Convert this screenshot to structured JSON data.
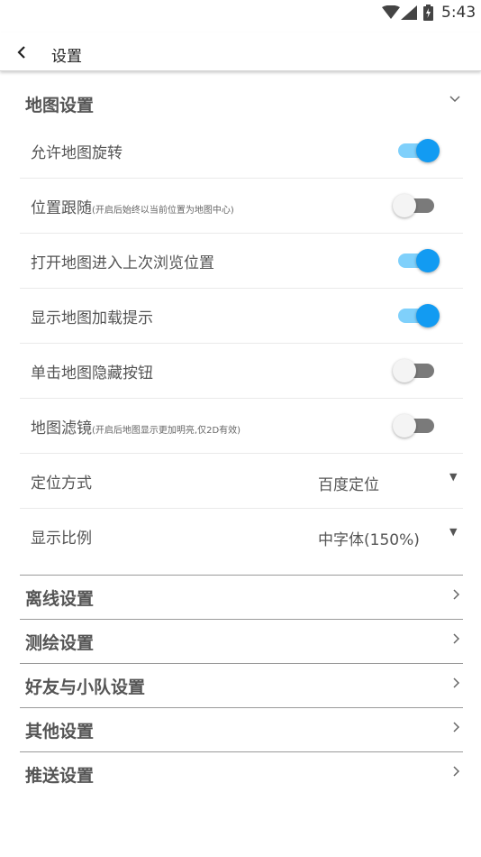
{
  "status_bar": {
    "time": "5:43",
    "wifi_icon": "wifi-icon",
    "signal_icon": "cell-signal-icon",
    "battery_icon": "battery-icon"
  },
  "toolbar": {
    "back_icon": "chevron-left-icon",
    "title": "设置"
  },
  "map_settings": {
    "title": "地图设置",
    "expand_icon": "chevron-down-icon",
    "switches": [
      {
        "label": "允许地图旋转",
        "hint": "",
        "on": true
      },
      {
        "label": "位置跟随",
        "hint": "(开启后始终以当前位置为地图中心)",
        "on": false
      },
      {
        "label": "打开地图进入上次浏览位置",
        "hint": "",
        "on": true
      },
      {
        "label": "显示地图加载提示",
        "hint": "",
        "on": true
      },
      {
        "label": "单击地图隐藏按钮",
        "hint": "",
        "on": false
      },
      {
        "label": "地图滤镜",
        "hint": "(开启后地图显示更加明亮,仅2D有效)",
        "on": false
      }
    ],
    "selects": [
      {
        "label": "定位方式",
        "value": "百度定位",
        "arrow": "▼"
      },
      {
        "label": "显示比例",
        "value": "中字体(150%)",
        "arrow": "▼"
      }
    ]
  },
  "sections": [
    {
      "label": "离线设置",
      "icon": "chevron-right-icon"
    },
    {
      "label": "测绘设置",
      "icon": "chevron-right-icon"
    },
    {
      "label": "好友与小队设置",
      "icon": "chevron-right-icon"
    },
    {
      "label": "其他设置",
      "icon": "chevron-right-icon"
    },
    {
      "label": "推送设置",
      "icon": "chevron-right-icon"
    }
  ],
  "colors": {
    "switch_on_thumb": "#129bf2",
    "switch_on_track": "#7fd0fb",
    "switch_off_thumb": "#f4f4f4",
    "switch_off_track": "#7a7a7a"
  }
}
